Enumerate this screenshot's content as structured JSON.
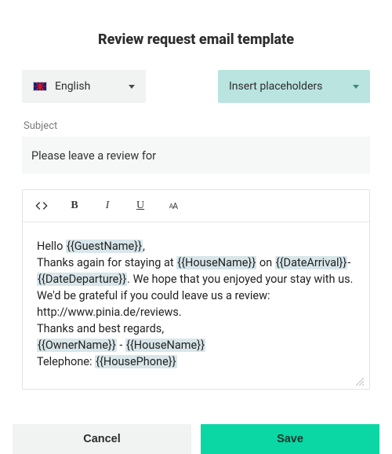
{
  "title": "Review request email template",
  "language_select": {
    "label": "English"
  },
  "placeholder_select": {
    "label": "Insert placeholders"
  },
  "subject": {
    "label": "Subject",
    "value": "Please leave a review for"
  },
  "toolbar": {
    "bold_glyph": "B",
    "italic_glyph": "I",
    "underline_glyph": "U"
  },
  "body": {
    "line1_pre": "Hello ",
    "ph_guest": "{{GuestName}}",
    "line1_post": ",",
    "line2_pre": "Thanks again for staying at ",
    "ph_house": "{{HouseName}}",
    "line2_mid": " on ",
    "ph_arr": "{{DateArrival}}",
    "line2_dash": "-",
    "ph_dep": "{{DateDeparture}}",
    "line2_post": ". We hope that you enjoyed your stay with us. We'd be grateful if you could leave us a review: http://www.pinia.de/reviews.",
    "line3": "Thanks and best regards,",
    "ph_owner": "{{OwnerName}}",
    "line4_sep": " - ",
    "ph_house2": "{{HouseName}}",
    "line5_pre": "Telephone: ",
    "ph_phone": "{{HousePhone}}"
  },
  "buttons": {
    "cancel": "Cancel",
    "save": "Save"
  }
}
